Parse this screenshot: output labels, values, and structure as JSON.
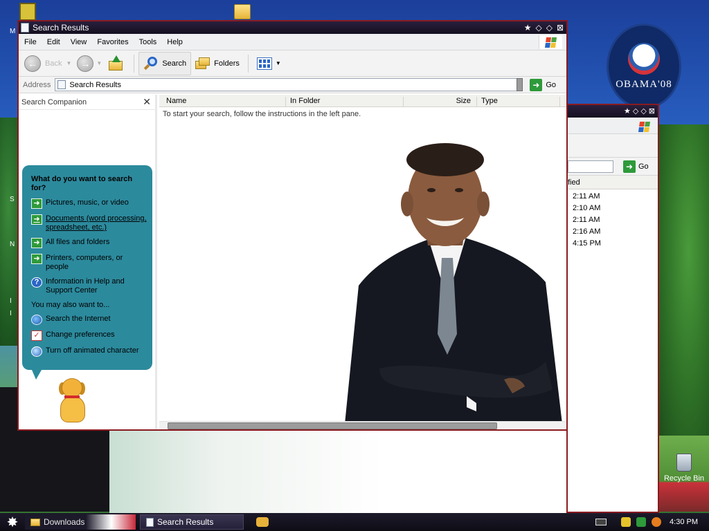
{
  "desktop": {
    "left_edge_letters": [
      "M",
      "S",
      "N",
      "I",
      "I"
    ],
    "logo_text": "OBAMA'08",
    "recycle_bin_label": "Recycle Bin"
  },
  "background_window": {
    "go_label": "Go",
    "column_header": "fied",
    "times": [
      "2:11 AM",
      "2:10 AM",
      "2:11 AM",
      "2:16 AM",
      "4:15 PM"
    ]
  },
  "window": {
    "title": "Search Results",
    "menu": [
      "File",
      "Edit",
      "View",
      "Favorites",
      "Tools",
      "Help"
    ],
    "toolbar": {
      "back_label": "Back",
      "search_label": "Search",
      "folders_label": "Folders"
    },
    "address": {
      "label": "Address",
      "value": "Search Results",
      "go_label": "Go"
    },
    "search_companion": {
      "header": "Search Companion",
      "question": "What do you want to search for?",
      "options": [
        "Pictures, music, or video",
        "Documents (word processing, spreadsheet, etc.)",
        "All files and folders",
        "Printers, computers, or people",
        "Information in Help and Support Center"
      ],
      "also_label": "You may also want to...",
      "also_options": [
        "Search the Internet",
        "Change preferences",
        "Turn off animated character"
      ]
    },
    "results": {
      "columns": [
        "Name",
        "In Folder",
        "Size",
        "Type"
      ],
      "hint": "To start your search, follow the instructions in the left pane."
    }
  },
  "taskbar": {
    "items": [
      "Downloads",
      "Search Results"
    ],
    "clock": "4:30 PM"
  },
  "colors": {
    "titlebar": "#1a1528",
    "window_border": "#8a1a1f",
    "balloon": "#2c8a9d",
    "go_green": "#2e9a3a"
  }
}
